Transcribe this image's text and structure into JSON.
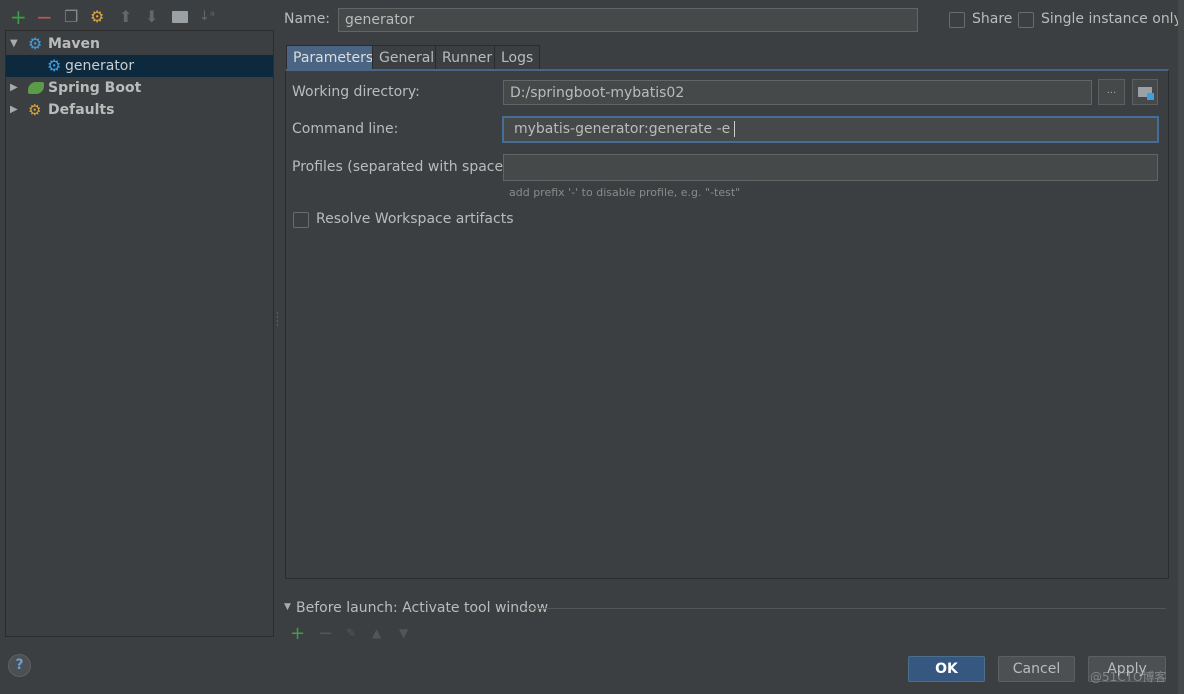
{
  "toolbar": {
    "icons": [
      "add-icon",
      "remove-icon",
      "copy-icon",
      "edit-defaults-icon",
      "move-up-icon",
      "move-down-icon",
      "folder-icon",
      "sort-icon"
    ]
  },
  "tree": {
    "items": [
      {
        "label": "Maven",
        "expanded": true,
        "bold": true,
        "icon": "maven-gear-icon"
      },
      {
        "label": "generator",
        "selected": true,
        "icon": "maven-gear-icon"
      },
      {
        "label": "Spring Boot",
        "expanded": false,
        "bold": true,
        "icon": "spring-boot-icon"
      },
      {
        "label": "Defaults",
        "expanded": false,
        "bold": true,
        "icon": "wrench-icon"
      }
    ]
  },
  "header": {
    "name_label": "Name:",
    "name_value": "generator",
    "share_label": "Share",
    "single_instance_label": "Single instance only"
  },
  "tabs": [
    {
      "label": "Parameters",
      "active": true
    },
    {
      "label": "General"
    },
    {
      "label": "Runner"
    },
    {
      "label": "Logs"
    }
  ],
  "form": {
    "working_dir_label": "Working directory:",
    "working_dir_value": "D:/springboot-mybatis02",
    "browse_label": "...",
    "command_line_label": "Command line:",
    "command_line_value": "mybatis-generator:generate -e",
    "profiles_label": "Profiles (separated with space):",
    "profiles_value": "",
    "profiles_hint": "add prefix '-' to disable profile, e.g. \"-test\"",
    "resolve_label": "Resolve Workspace artifacts",
    "resolve_checked": false
  },
  "before_launch": {
    "label": "Before launch: Activate tool window"
  },
  "buttons": {
    "ok": "OK",
    "cancel": "Cancel",
    "apply": "Apply",
    "help": "?"
  },
  "watermark": "@51CTO博客",
  "colors": {
    "background": "#3c3f41",
    "selection": "#0d293e",
    "accent": "#365880",
    "add_green": "#3c9e46",
    "remove_red": "#c75450"
  }
}
